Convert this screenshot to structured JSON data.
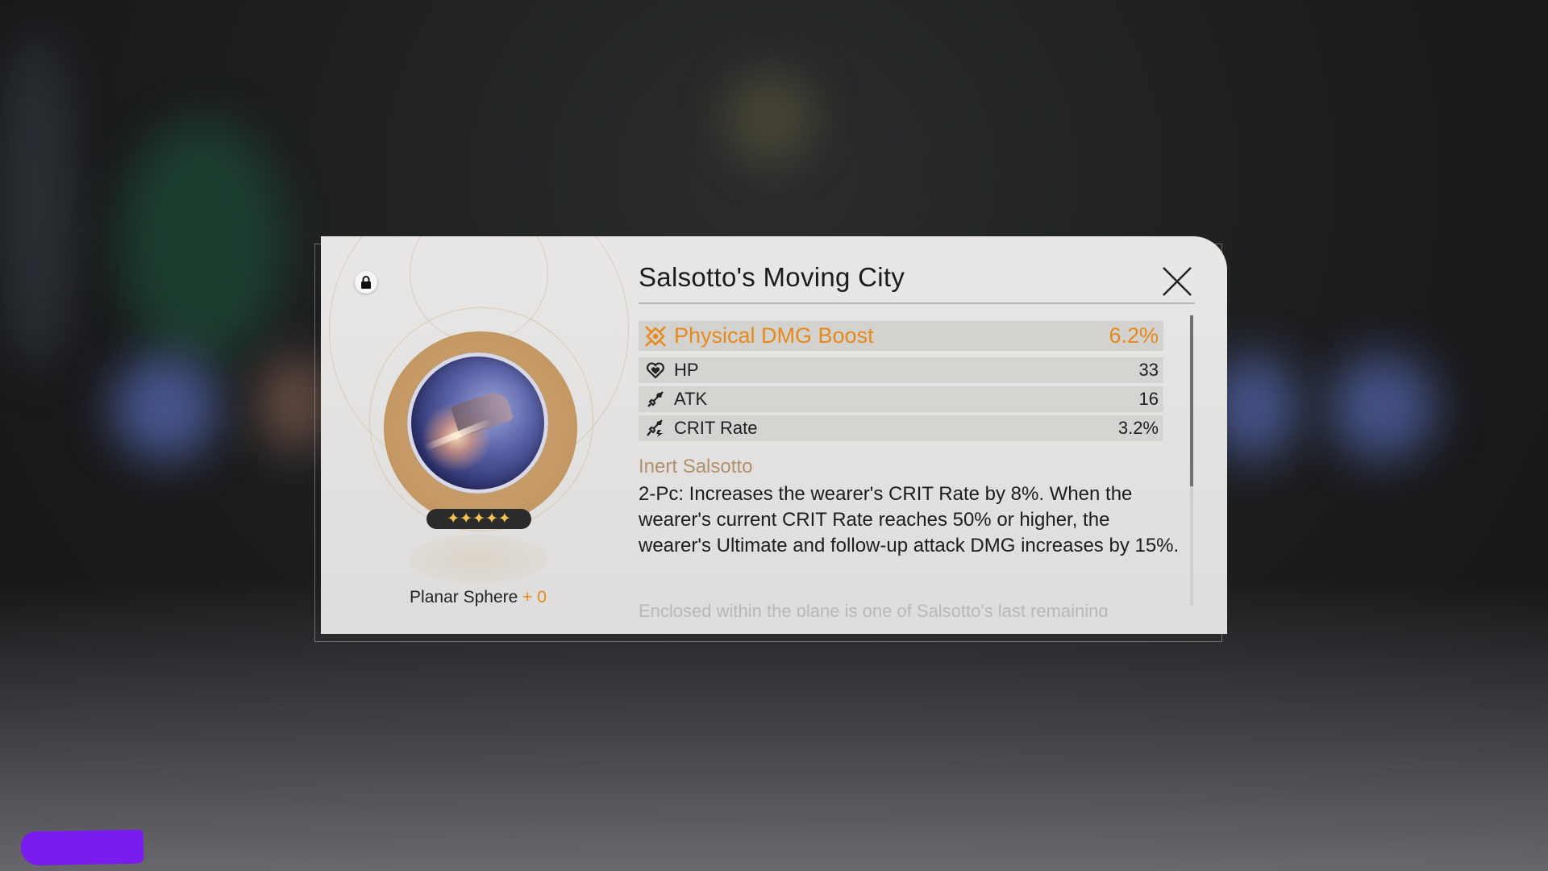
{
  "item": {
    "name": "Salsotto's Moving City",
    "type_label": "Planar Sphere",
    "level_label": "+ 0",
    "rarity_stars": 5,
    "stars_text": "✦✦✦✦✦"
  },
  "main_stat": {
    "name": "Physical DMG Boost",
    "value": "6.2%",
    "icon": "physical-dmg-icon"
  },
  "sub_stats": [
    {
      "name": "HP",
      "value": "33",
      "icon": "heart-icon"
    },
    {
      "name": "ATK",
      "value": "16",
      "icon": "sword-icon"
    },
    {
      "name": "CRIT Rate",
      "value": "3.2%",
      "icon": "crit-rate-icon"
    }
  ],
  "set": {
    "name": "Inert Salsotto",
    "description": "2-Pc: Increases the wearer's CRIT Rate by 8%. When the wearer's current CRIT Rate reaches 50% or higher, the wearer's Ultimate and follow-up attack DMG increases by 15%.",
    "lore_partial": "Enclosed within the plane is one of Salsotto's last remaining"
  },
  "scroll": {
    "position_fraction": 0.0
  },
  "colors": {
    "accent_orange": "#e7891a",
    "set_name_tan": "#b08f6c",
    "star_gold": "#f3c453",
    "redaction_purple": "#7a1cf0"
  },
  "icons": {
    "lock": "lock-icon",
    "close": "close-icon"
  }
}
